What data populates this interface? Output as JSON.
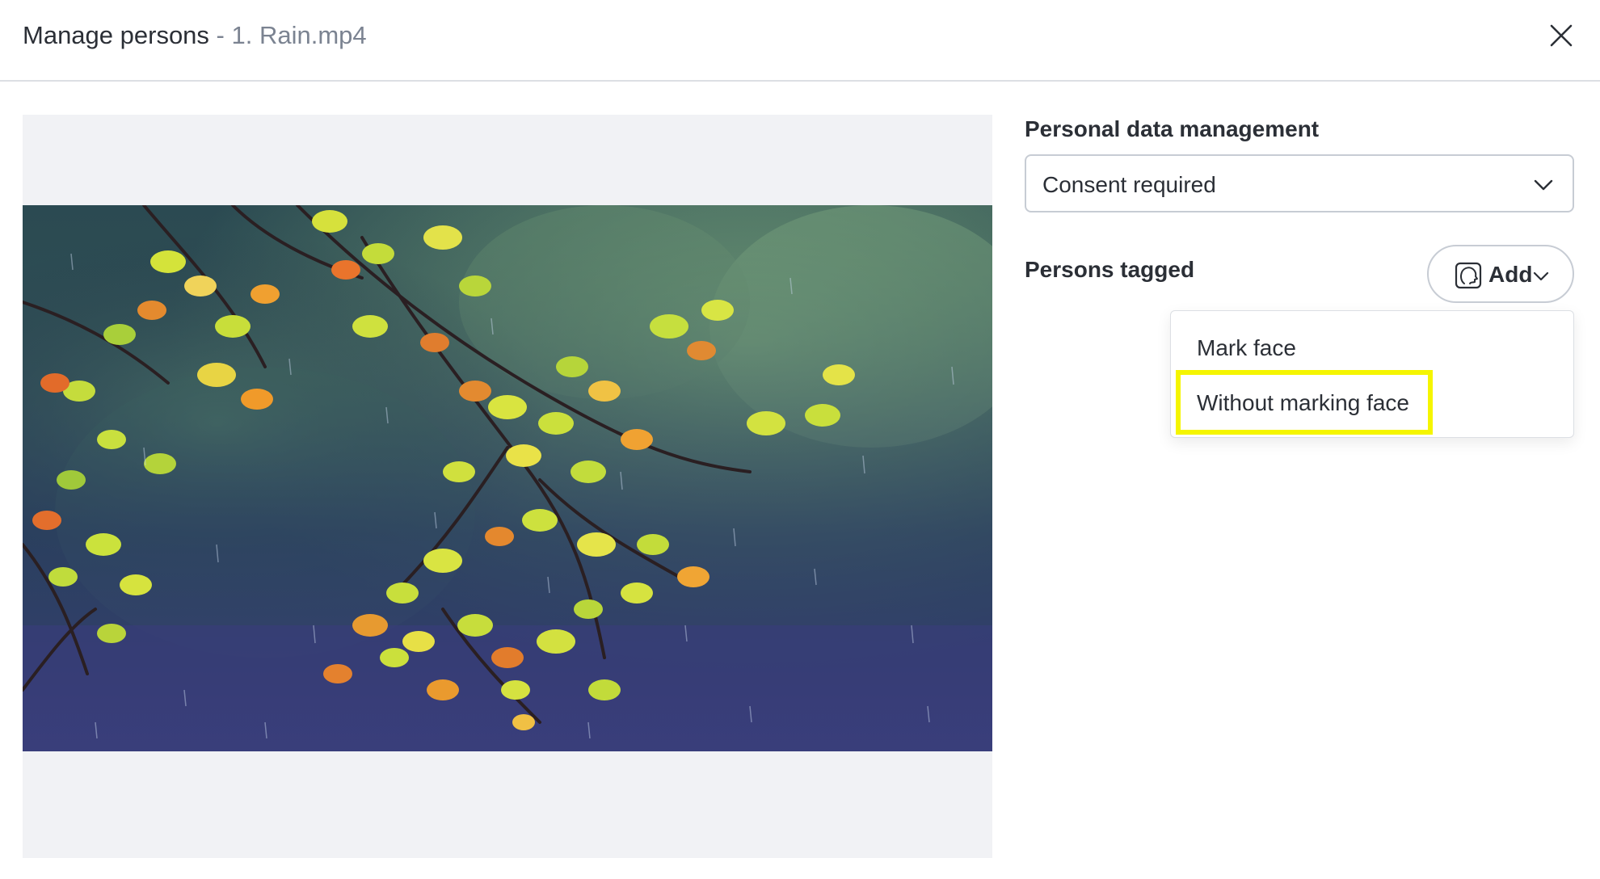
{
  "dialog": {
    "title": "Manage persons",
    "separator": " - ",
    "file_name": "1. Rain.mp4",
    "close_icon": "close-icon"
  },
  "preview": {
    "media": "video-preview"
  },
  "personal_data": {
    "label": "Personal data management",
    "selected": "Consent required"
  },
  "persons": {
    "label": "Persons tagged",
    "add_label": "Add",
    "add_icon": "face-icon"
  },
  "add_menu": {
    "items": [
      {
        "label": "Mark face"
      },
      {
        "label": "Without marking face"
      }
    ],
    "highlight_color": "#f5f500"
  }
}
